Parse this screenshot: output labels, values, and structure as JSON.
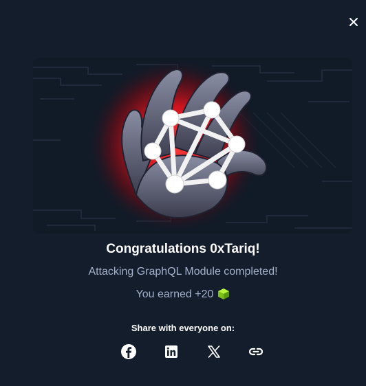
{
  "modal": {
    "title": "Congratulations 0xTariq!",
    "subtitle": "Attacking GraphQL Module completed!",
    "earned_text": "You earned +20",
    "share_label": "Share with everyone on:"
  },
  "icons": {
    "close": "close-icon",
    "cube": "cube-icon",
    "share": [
      "facebook-icon",
      "linkedin-icon",
      "x-icon",
      "link-icon"
    ]
  },
  "colors": {
    "background": "#141d2b",
    "text_primary": "#ffffff",
    "text_secondary": "#a4b1cd",
    "accent_green": "#9fef00",
    "glow_red": "#e8202a"
  }
}
